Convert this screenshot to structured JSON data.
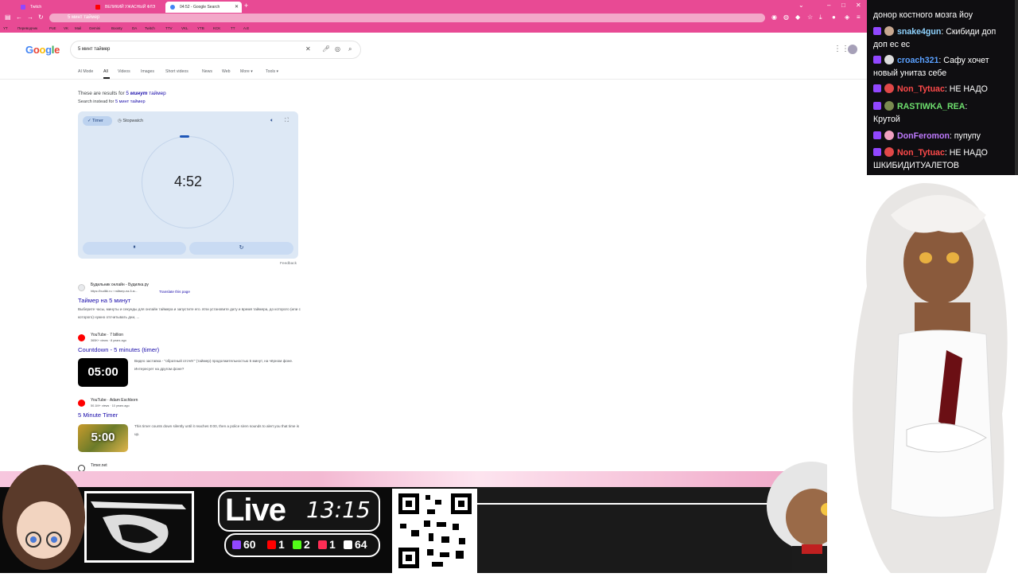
{
  "browser": {
    "tabs": [
      {
        "label": "Twitch",
        "active": false
      },
      {
        "label": "ВЕЛИКИЙ УЖАСНЫЙ ФЛЭ",
        "active": false
      },
      {
        "label": "04:52 - Google Search",
        "active": true
      }
    ],
    "new_tab": "+",
    "url": "5 минт таймер",
    "bookmarks": [
      "YT",
      "Переводчик",
      "PoE",
      "VK",
      "Mail",
      "Gemini",
      "Boosty",
      "DA",
      "Twitch",
      "TTV",
      "VKL",
      "YTB",
      "KCK",
      "TT",
      "A.E"
    ]
  },
  "google": {
    "logo": "Google",
    "query": "5 минт таймер",
    "tabs": [
      "AI Mode",
      "All",
      "Videos",
      "Images",
      "Short videos",
      "News",
      "Web",
      "More ▾",
      "Tools ▾"
    ],
    "results_for_prefix": "These are results for ",
    "results_for_link": "5",
    "results_for_bold": "минут",
    "results_for_suffix": "таймер",
    "search_instead_prefix": "Search instead for ",
    "search_instead_link": "5 минт таймер"
  },
  "timer": {
    "chip_timer": "✓ Timer",
    "chip_stopwatch": "Stopwatch",
    "display": "4:52",
    "pause_icon": "⏸",
    "reset_icon": "↻",
    "feedback": "Feedback",
    "sound_icon": "speaker-icon",
    "progress_fraction": 0.97
  },
  "results": [
    {
      "site": "Будильник онлайн - Будилка.ру",
      "url": "https://budilki.ru › таймер-на-5-м...",
      "translate": "Translate this page",
      "title": "Таймер на 5 минут",
      "snippet": "Выберите часы, минуты и секунды для онлайн таймера и запустите его. Или установите дату и время таймера, до которого (или с которого) нужно отсчитывать дни, ..."
    },
    {
      "site": "YouTube · 7 billion",
      "url": "365K+ views · 8 years ago",
      "title": "Countdown - 5 minutes (timer)",
      "snippet": "Видео заставка - \"обратный отсчёт\" (таймер) продолжительностью 5 минут, на чёрном фоне. Интересует на другом фоне?",
      "thumb": "05:00"
    },
    {
      "site": "YouTube · Adam Eschborn",
      "url": "50.1M+ views · 10 years ago",
      "title": "5 Minute Timer",
      "snippet": "This timer counts down silently until it reaches 0:00, then a police siren sounds to alert you that time is up.",
      "thumb": "5:00"
    },
    {
      "site": "Timer.net"
    }
  ],
  "stream": {
    "live": "Live",
    "time": "13:15",
    "stats": [
      {
        "platform": "twitch",
        "count": "60",
        "color": "#9147ff"
      },
      {
        "platform": "youtube",
        "count": "1",
        "color": "#ff0000"
      },
      {
        "platform": "kick",
        "count": "2",
        "color": "#53fc18"
      },
      {
        "platform": "vk-live",
        "count": "1",
        "color": "#ff2d55"
      },
      {
        "platform": "trovo",
        "count": "64",
        "color": "#ffffff"
      }
    ]
  },
  "chat": [
    {
      "user": "",
      "text": "донор костного мозга йоу",
      "color": "#ffffff"
    },
    {
      "user": "snake4gun",
      "text": ": Скибиди доп",
      "color": "#8fd3ff"
    },
    {
      "user": "",
      "text": "доп ес ес",
      "color": "#ffffff"
    },
    {
      "user": "croach321",
      "text": ": Сафу хочет",
      "color": "#5aa0ff"
    },
    {
      "user": "",
      "text": "новый унитаз себе",
      "color": "#ffffff"
    },
    {
      "user": "Non_Tytuac",
      "text": ": НЕ НАДО",
      "color": "#ff4a4a"
    },
    {
      "user": "RASTIWKA_REA",
      "text": ":",
      "color": "#6ee06e"
    },
    {
      "user": "",
      "text": "Крутой",
      "color": "#ffffff"
    },
    {
      "user": "DonFeromon",
      "text": ": пупупу",
      "color": "#c07bff"
    },
    {
      "user": "Non_Tytuac",
      "text": ": НЕ НАДО",
      "color": "#ff4a4a"
    },
    {
      "user": "",
      "text": "ШКИБИДИТУАЛЕТОВ",
      "color": "#ffffff"
    }
  ]
}
